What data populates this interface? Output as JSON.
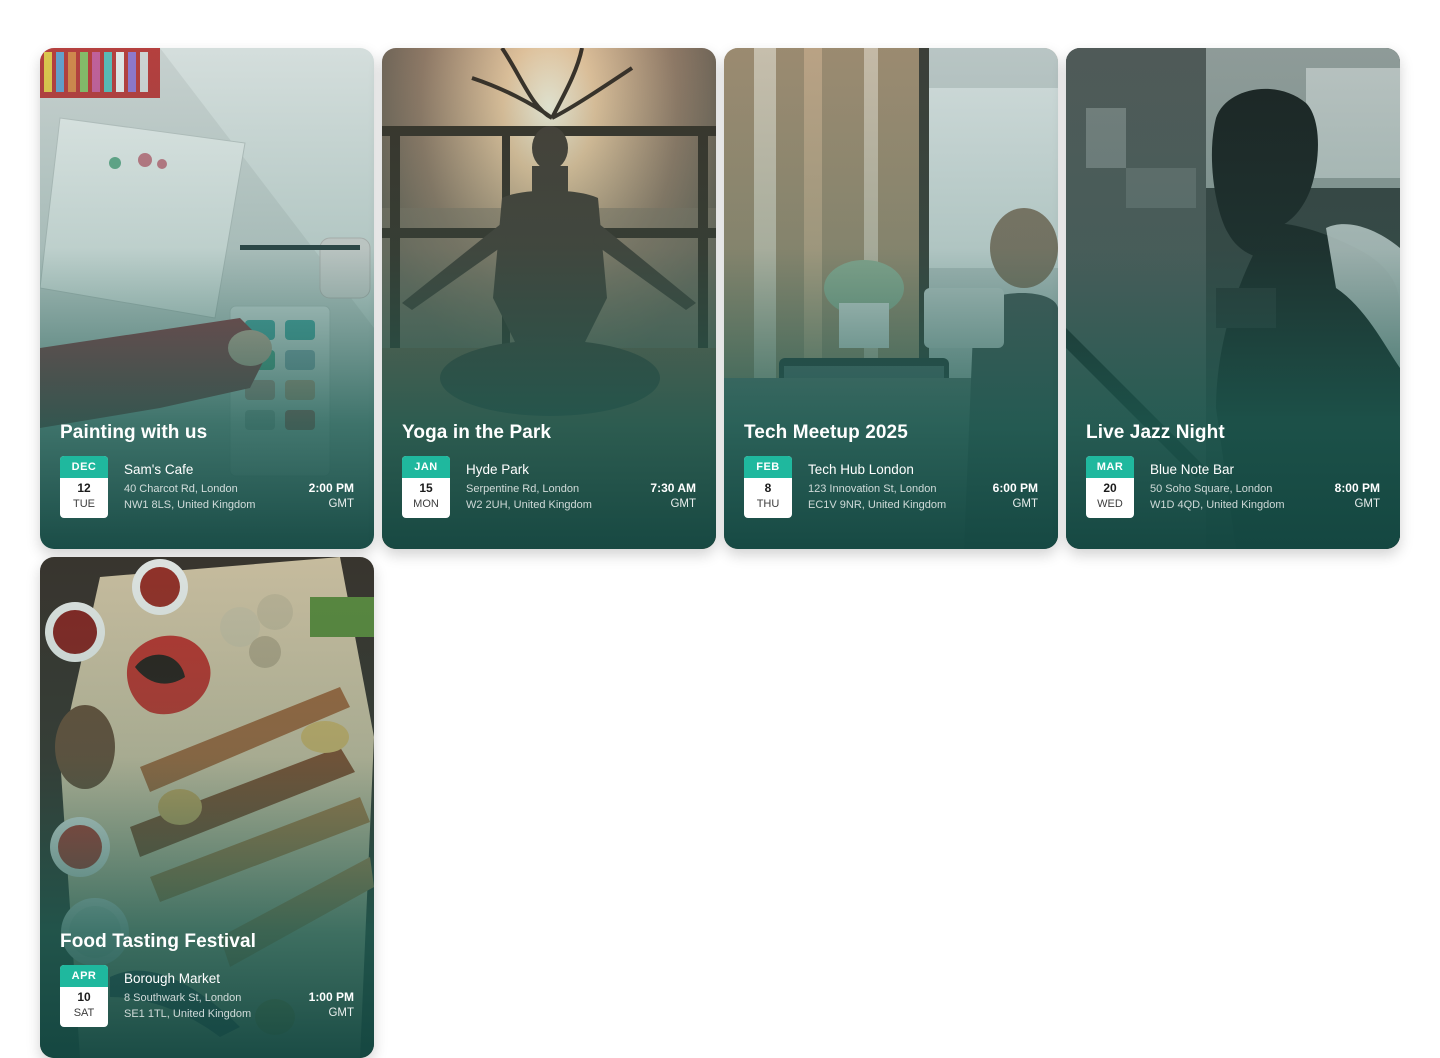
{
  "events": [
    {
      "title": "Painting with us",
      "month": "DEC",
      "day": "12",
      "weekday": "TUE",
      "venue": "Sam's Cafe",
      "address_line1": "40 Charcot Rd, London",
      "address_line2": "NW1 8LS, United Kingdom",
      "time": "2:00 PM",
      "timezone": "GMT",
      "image_icon": "painting-photo"
    },
    {
      "title": "Yoga in the Park",
      "month": "JAN",
      "day": "15",
      "weekday": "MON",
      "venue": "Hyde Park",
      "address_line1": "Serpentine Rd, London",
      "address_line2": "W2 2UH, United Kingdom",
      "time": "7:30 AM",
      "timezone": "GMT",
      "image_icon": "yoga-photo"
    },
    {
      "title": "Tech Meetup 2025",
      "month": "FEB",
      "day": "8",
      "weekday": "THU",
      "venue": "Tech Hub London",
      "address_line1": "123 Innovation St, London",
      "address_line2": "EC1V 9NR, United Kingdom",
      "time": "6:00 PM",
      "timezone": "GMT",
      "image_icon": "tech-photo"
    },
    {
      "title": "Live Jazz Night",
      "month": "MAR",
      "day": "20",
      "weekday": "WED",
      "venue": "Blue Note Bar",
      "address_line1": "50 Soho Square, London",
      "address_line2": "W1D 4QD, United Kingdom",
      "time": "8:00 PM",
      "timezone": "GMT",
      "image_icon": "jazz-photo"
    },
    {
      "title": "Food Tasting Festival",
      "month": "APR",
      "day": "10",
      "weekday": "SAT",
      "venue": "Borough Market",
      "address_line1": "8 Southwark St, London",
      "address_line2": "SE1 1TL, United Kingdom",
      "time": "1:00 PM",
      "timezone": "GMT",
      "image_icon": "food-photo"
    }
  ],
  "colors": {
    "badge_accent": "#1fb89e",
    "overlay_dark": "#14483f"
  }
}
